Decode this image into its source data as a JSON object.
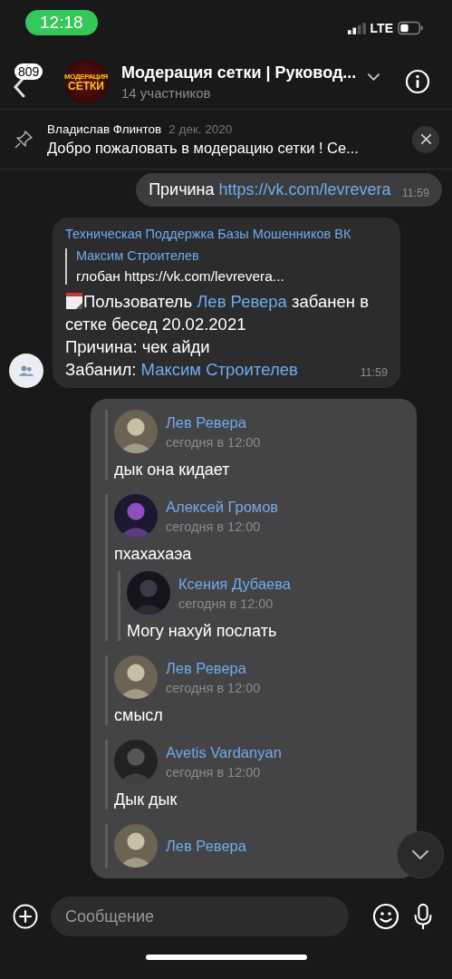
{
  "status_bar": {
    "time": "12:18",
    "network": "LTE"
  },
  "header": {
    "unread_count": "809",
    "avatar_lines": [
      "МОДЕРАЦИЯ",
      "СЕТКИ"
    ],
    "title": "Модерация сетки | Руковод...",
    "subtitle": "14 участников"
  },
  "pinned": {
    "author": "Владислав Флинтов",
    "date": "2 дек. 2020",
    "text": "Добро пожаловать в модерацию сетки ! Се..."
  },
  "messages": [
    {
      "kind": "outgoing",
      "parts": [
        {
          "text": "Причина "
        },
        {
          "text": "https://vk.com/levrevera",
          "link": true
        }
      ],
      "time": "11:59"
    },
    {
      "kind": "incoming",
      "sender": "Техническая Поддержка Базы Мошенников ВК",
      "reply": {
        "author": "Максим Строителев",
        "text": "глобан https://vk.com/levrevera..."
      },
      "lines": [
        [
          {
            "text": "Пользователь "
          },
          {
            "text": "Лев Ревера",
            "link": true
          },
          {
            "text": " забанен в сетке бесед 20.02.2021"
          }
        ],
        [
          {
            "text": "Причина: чек айди"
          }
        ],
        [
          {
            "text": "Забанил: "
          },
          {
            "text": "Максим Строителев",
            "link": true
          }
        ]
      ],
      "time": "11:59"
    },
    {
      "kind": "forwarded",
      "items": [
        {
          "author": "Лев Ревера",
          "time": "сегодня в 12:00",
          "text": "дык она кидает"
        },
        {
          "author": "Алексей Громов",
          "time": "сегодня в 12:00",
          "text": "пхахахаэа",
          "children": [
            {
              "author": "Ксения Дубаева",
              "time": "сегодня в 12:00",
              "text": "Могу нахуй послать"
            }
          ]
        },
        {
          "author": "Лев Ревера",
          "time": "сегодня в 12:00",
          "text": "смысл"
        },
        {
          "author": "Avetis Vardanyan",
          "time": "сегодня в 12:00",
          "text": "Дык дык"
        },
        {
          "author": "Лев Ревера"
        }
      ]
    }
  ],
  "composer": {
    "placeholder": "Сообщение"
  }
}
